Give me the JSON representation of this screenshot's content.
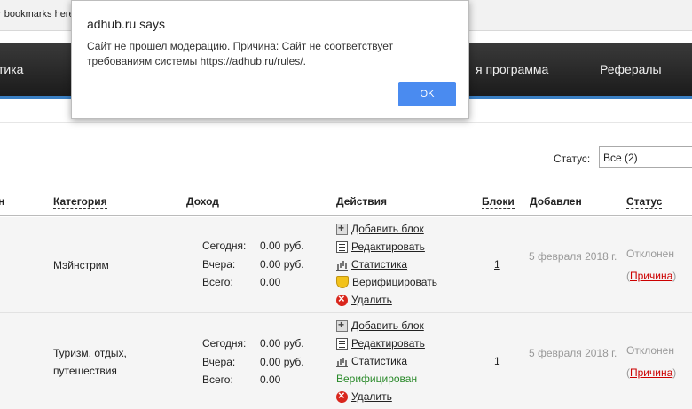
{
  "browser": {
    "bookmarks_bar_text": "r bookmarks here"
  },
  "nav": {
    "items": [
      "тика",
      "я программа",
      "Рефералы"
    ]
  },
  "filter": {
    "status_label": "Статус:",
    "status_value": "Все (2)"
  },
  "table": {
    "headers": {
      "name": "н",
      "category": "Категория",
      "income": "Доход",
      "actions": "Действия",
      "blocks": "Блоки",
      "added": "Добавлен",
      "status": "Статус"
    },
    "income_labels": {
      "today": "Сегодня:",
      "yesterday": "Вчера:",
      "total": "Всего:"
    },
    "actions": {
      "add_block": "Добавить блок",
      "edit": "Редактировать",
      "stats": "Статистика",
      "verify": "Верифицировать",
      "delete": "Удалить",
      "verified": "Верифицирован"
    },
    "rows": [
      {
        "category": "Мэйнстрим",
        "today": "0.00 руб.",
        "yesterday": "0.00 руб.",
        "total": "0.00",
        "blocks": "1",
        "added": "5 февраля 2018 г.",
        "status": "Отклонен",
        "reason_open": "(",
        "reason": "Причина",
        "reason_close": ")"
      },
      {
        "category_line1": "Туризм, отдых,",
        "category_line2": "путешествия",
        "today": "0.00 руб.",
        "yesterday": "0.00 руб.",
        "total": "0.00",
        "blocks": "1",
        "added": "5 февраля 2018 г.",
        "status": "Отклонен",
        "reason_open": "(",
        "reason": "Причина",
        "reason_close": ")"
      }
    ]
  },
  "dialog": {
    "title": "adhub.ru says",
    "message": "Сайт не прошел модерацию. Причина: Сайт не соответствует требованиям системы https://adhub.ru/rules/.",
    "ok_label": "OK"
  }
}
